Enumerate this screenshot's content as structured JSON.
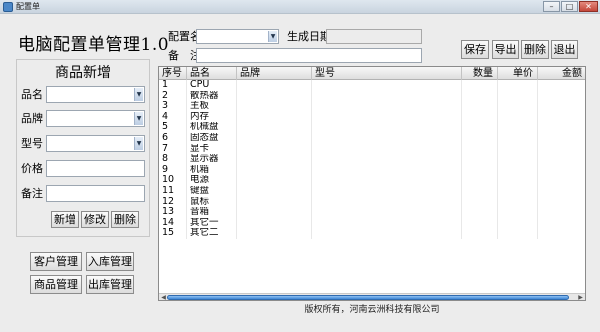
{
  "window": {
    "title": "配置单",
    "min": "–",
    "max": "□",
    "close": "✕"
  },
  "app_title": "电脑配置单管理1.0",
  "new_item": {
    "title": "商品新增",
    "name_label": "品名",
    "name_value": "",
    "brand_label": "品牌",
    "brand_value": "",
    "model_label": "型号",
    "model_value": "",
    "price_label": "价格",
    "price_value": "",
    "note_label": "备注",
    "note_value": "",
    "add_btn": "新增",
    "edit_btn": "修改",
    "delete_btn": "删除"
  },
  "nav": {
    "customer": "客户管理",
    "stock_in": "入库管理",
    "product": "商品管理",
    "stock_out": "出库管理"
  },
  "config": {
    "name_label": "配置名",
    "name_value": "",
    "date_label": "生成日期",
    "date_value": "",
    "note_label": "备　注",
    "note_value": ""
  },
  "toolbar": {
    "save": "保存",
    "export": "导出",
    "delete": "删除",
    "exit": "退出"
  },
  "dropdown_glyph": "▼",
  "table": {
    "headers": [
      "序号",
      "品名",
      "品牌",
      "型号",
      "数量",
      "单价",
      "金额"
    ],
    "rows": [
      [
        "1",
        "CPU"
      ],
      [
        "2",
        "散热器"
      ],
      [
        "3",
        "主板"
      ],
      [
        "4",
        "内存"
      ],
      [
        "5",
        "机械盘"
      ],
      [
        "6",
        "固态盘"
      ],
      [
        "7",
        "显卡"
      ],
      [
        "8",
        "显示器"
      ],
      [
        "9",
        "机箱"
      ],
      [
        "10",
        "电源"
      ],
      [
        "11",
        "键盘"
      ],
      [
        "12",
        "鼠标"
      ],
      [
        "13",
        "音箱"
      ],
      [
        "14",
        "其它一"
      ],
      [
        "15",
        "其它二"
      ]
    ],
    "scroll_left": "◀",
    "scroll_right": "▶"
  },
  "footer": "版权所有，河南云洲科技有限公司"
}
